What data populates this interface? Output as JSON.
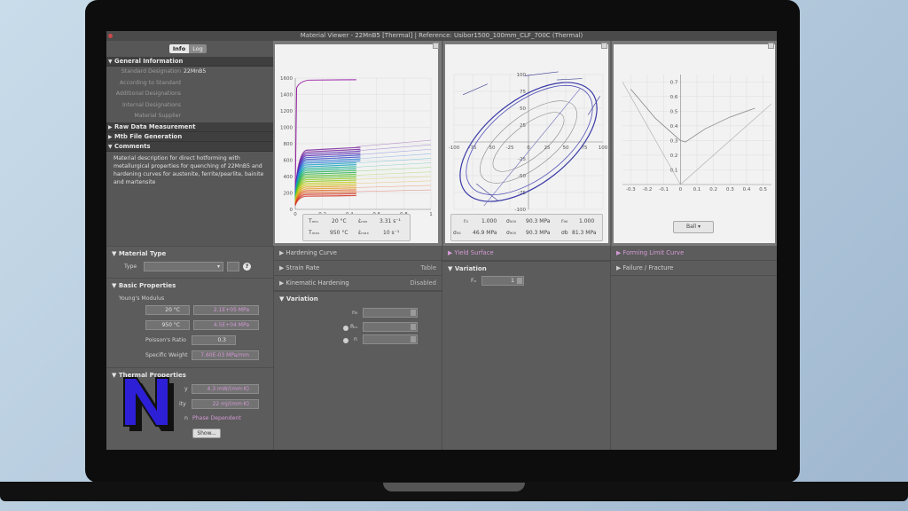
{
  "window": {
    "title": "Material Viewer - 22MnB5 [Thermal] | Reference: Usibor1500_100mm_CLF_700C (Thermal)"
  },
  "info_panel": {
    "tabs": [
      "Info",
      "Log"
    ],
    "sections": {
      "general": "General Information",
      "raw": "Raw Data Measurement",
      "mtb": "Mtb File Generation",
      "comments": "Comments"
    },
    "rows": [
      {
        "label": "Standard Designation",
        "value": "22MnB5"
      },
      {
        "label": "According to Standard",
        "value": ""
      },
      {
        "label": "Additional Designations",
        "value": ""
      },
      {
        "label": "Internal Designations",
        "value": ""
      },
      {
        "label": "Material Supplier",
        "value": ""
      }
    ],
    "comment_lines": [
      "Material description for direct hotforming with",
      "metallurgical properties for quenching of 22MnB5 and",
      "hardening curves for austenite, ferrite/pearlite, bainite",
      "and martensite"
    ]
  },
  "flow_curve": {
    "y_ticks": [
      "1600",
      "1400",
      "1200",
      "1000",
      "800",
      "600",
      "400",
      "200",
      "0"
    ],
    "x_ticks": [
      "0",
      "0.2",
      "0.4",
      "0.6",
      "0.8",
      "1"
    ],
    "readout": {
      "t_min_lbl": "Tₘᵢₙ",
      "t_min_val": "20 °C",
      "t_max_lbl": "Tₘₐₓ",
      "t_max_val": "950 °C",
      "rate_min_lbl": "ε̇ₘᵢₙ",
      "rate_min_val": "3.31 s⁻¹",
      "rate_max_lbl": "ε̇ₘₐₓ",
      "rate_max_val": "10 s⁻¹"
    }
  },
  "yield_surface": {
    "x_ticks": [
      "-100",
      "-75",
      "-50",
      "-25",
      "0",
      "25",
      "50",
      "75",
      "100"
    ],
    "y_ticks": [
      "100",
      "75",
      "50",
      "25",
      "0",
      "-25",
      "-50",
      "-75",
      "-100"
    ],
    "readout": {
      "r00_lbl": "r₀",
      "r00_val": "1.000",
      "r90_lbl": "r₉₀",
      "r90_val": "1.000",
      "s00_lbl": "σ₀₀₀",
      "s00_val": "90.3 MPa",
      "s45_lbl": "σ₄₅",
      "s45_val": "46.9 MPa",
      "s90_lbl": "σ₉₀₀",
      "s90_val": "90.3 MPa",
      "sb_lbl": "σb",
      "sb_val": "81.3 MPa"
    }
  },
  "flc": {
    "y_ticks": [
      "0.7",
      "0.6",
      "0.5",
      "0.4",
      "0.3",
      "0.2",
      "0.1"
    ],
    "x_ticks": [
      "-0.3",
      "-0.2",
      "-0.1",
      "0",
      "0.1",
      "0.2",
      "0.3",
      "0.4",
      "0.5"
    ],
    "button": "Ball"
  },
  "material_type": {
    "header": "Material Type",
    "type_label": "Type",
    "help": "?"
  },
  "basic_properties": {
    "header": "Basic Properties",
    "youngs_label": "Young's Modulus",
    "temp1": "20 °C",
    "modulus1": "2.1E+05 MPa",
    "temp2": "950 °C",
    "modulus2": "4.5E+04 MPa",
    "poisson_label": "Poisson's Ratio",
    "poisson_val": "0.3",
    "weight_label": "Specific Weight",
    "weight_val": "7.60E-03 MPa/mm"
  },
  "thermal_properties": {
    "header": "Thermal Properties",
    "conductivity_label": "y",
    "conductivity_val": "4.3 mW/(mm·K)",
    "capacity_label": "ity",
    "capacity_val": "22 mJ/(mm·K)",
    "phase_label": "n",
    "phase_val": "Phase Dependent",
    "show_btn": "Show..."
  },
  "hardening": {
    "curve": "Hardening Curve",
    "strain_rate": "Strain Rate",
    "strain_rate_val": "Table",
    "kinematic": "Kinematic Hardening",
    "kinematic_val": "Disabled",
    "variation": "Variation",
    "n_label": "n₀",
    "rm_label": "Rₘ",
    "nn_label": "n"
  },
  "yield_panel": {
    "title": "Yield Surface",
    "variation": "Variation",
    "f_label": "Fₐ",
    "f_val": "1"
  },
  "flc_panel": {
    "title": "Forming Limit Curve",
    "failure": "Failure / Fracture"
  },
  "colors": {
    "accent_pink": "#d49ad6",
    "panel_bg": "#5e5e5e",
    "plot_bg": "#f2f2f2"
  }
}
